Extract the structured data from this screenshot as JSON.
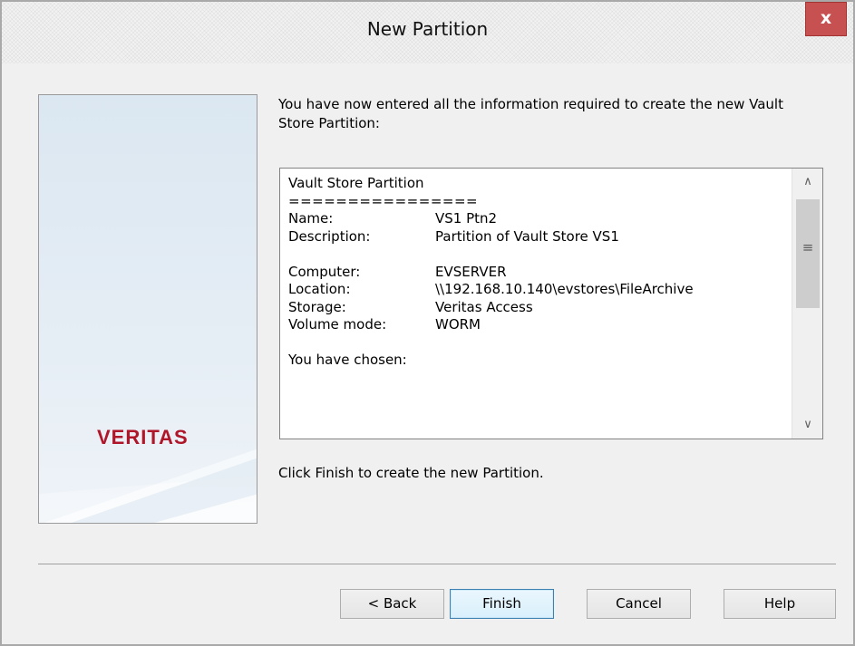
{
  "window": {
    "title": "New Partition",
    "close_label": "x"
  },
  "side_panel": {
    "logo_text": "VERITAS",
    "logo_color": "#b0162a"
  },
  "intro_text": "You have now entered all the information required to create the new Vault Store Partition:",
  "summary": {
    "heading": "Vault Store Partition",
    "separator": "================",
    "name_label": "Name:",
    "name_value": "VS1 Ptn2",
    "description_label": "Description:",
    "description_value": "Partition of Vault Store VS1",
    "computer_label": "Computer:",
    "computer_value": "EVSERVER",
    "location_label": "Location:",
    "location_value": "\\\\192.168.10.140\\evstores\\FileArchive",
    "storage_label": "Storage:",
    "storage_value": "Veritas Access",
    "volume_mode_label": "Volume mode:",
    "volume_mode_value": "WORM",
    "chosen_text": "You have chosen:"
  },
  "scrollbar": {
    "up_icon": "chevron-up-icon",
    "down_icon": "chevron-down-icon",
    "grip_icon": "grip-icon"
  },
  "footer_note": "Click Finish to create the new Partition.",
  "buttons": {
    "back": "< Back",
    "finish": "Finish",
    "cancel": "Cancel",
    "help": "Help"
  },
  "colors": {
    "close_button": "#c75050",
    "default_button_border": "#3c7fb1"
  }
}
